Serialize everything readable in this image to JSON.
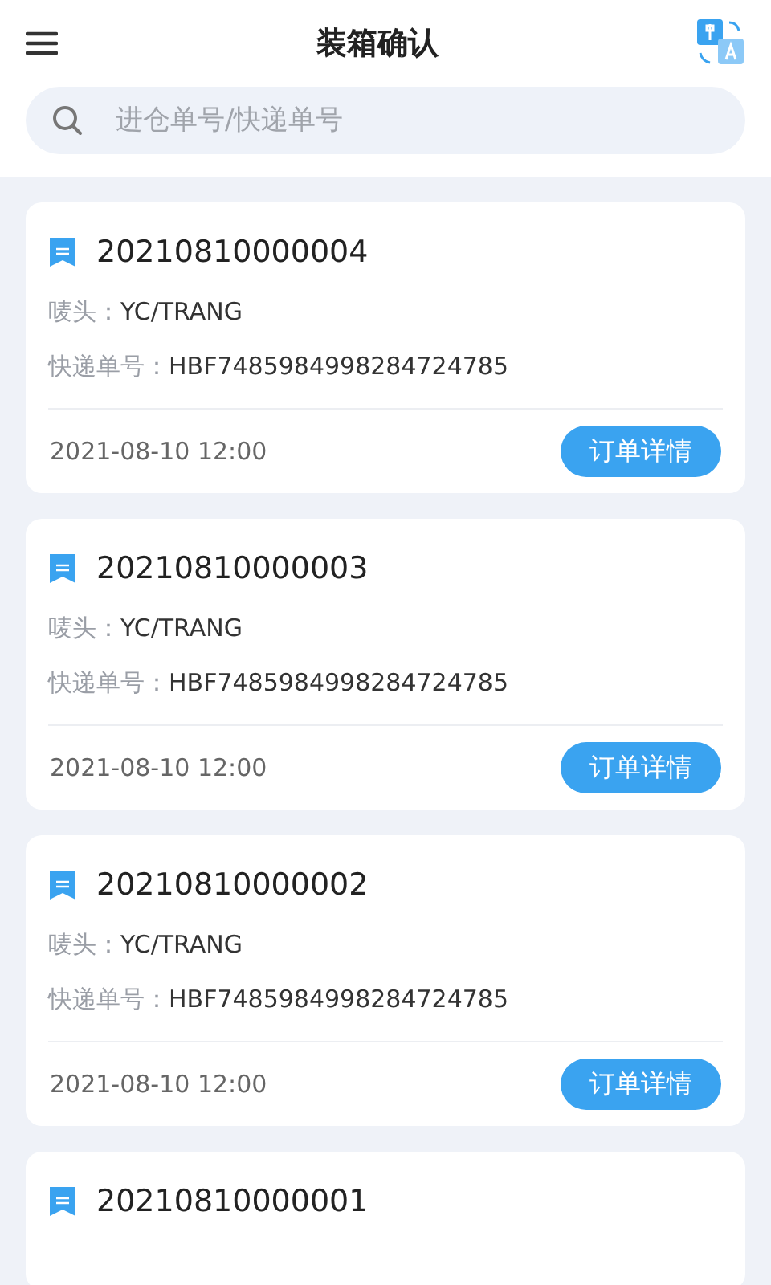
{
  "header": {
    "title": "装箱确认"
  },
  "search": {
    "placeholder": "进仓单号/快递单号"
  },
  "orders": [
    {
      "number": "20210810000004",
      "fields": [
        {
          "label": "唛头：",
          "value": "YC/TRANG"
        },
        {
          "label": "快递单号：",
          "value": "HBF7485984998284724785"
        }
      ],
      "date": "2021-08-10 12:00",
      "button": "订单详情"
    },
    {
      "number": "20210810000003",
      "fields": [
        {
          "label": "唛头：",
          "value": "YC/TRANG"
        },
        {
          "label": "快递单号：",
          "value": "HBF7485984998284724785"
        }
      ],
      "date": "2021-08-10 12:00",
      "button": "订单详情"
    },
    {
      "number": "20210810000002",
      "fields": [
        {
          "label": "唛头：",
          "value": "YC/TRANG"
        },
        {
          "label": "快递单号：",
          "value": "HBF7485984998284724785"
        }
      ],
      "date": "2021-08-10 12:00",
      "button": "订单详情"
    },
    {
      "number": "20210810000001"
    }
  ]
}
